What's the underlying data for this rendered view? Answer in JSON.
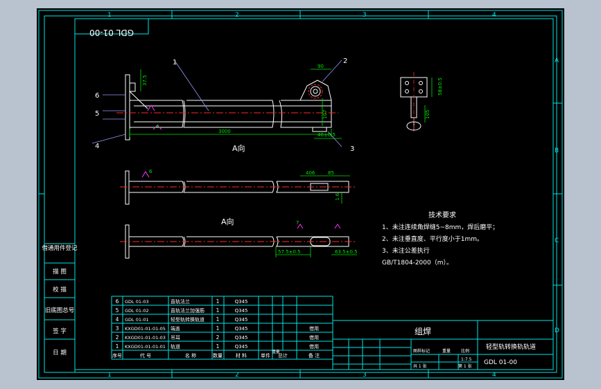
{
  "colors": {
    "background": "#b9c2cf",
    "sheet": "#000000",
    "frame": "#00e6e6",
    "object": "#ffffff",
    "center_line": "#ff2a2a",
    "dimension": "#00e600",
    "annotation": "#00e600",
    "leader": "#9999ff",
    "weld": "#ff33ff"
  },
  "border_zones": {
    "columns": [
      "1",
      "2",
      "3",
      "4"
    ],
    "rows": [
      "A",
      "B",
      "C",
      "D"
    ]
  },
  "drawing_code_mirrored": "GDL 01-00",
  "views": {
    "main_view_label": "A向",
    "bottom_view_label": "A向"
  },
  "balloons": [
    "1",
    "2",
    "3",
    "4",
    "5",
    "6"
  ],
  "dimensions": {
    "overall_length": "3000",
    "d_90": "90",
    "d_46": "46±0.5",
    "d_37": "37.5",
    "d_107": "107",
    "d_4": "4",
    "d_58": "58±0.5",
    "d_105": "105",
    "d_406": "406",
    "d_85": "85",
    "d_16": "1.6",
    "d_575": "57.5±0.5",
    "d_635": "63.5±0.5",
    "weld_6": "6",
    "weld_7": "7"
  },
  "technical_requirements": {
    "title": "技术要求",
    "lines": [
      "1、未注连续角焊缝5~8mm，焊后磨平；",
      "2、未注垂直度、平行度小于1mm。",
      "3、未注公差执行",
      "GB/T1804-2000（m）。"
    ]
  },
  "side_panel": {
    "items": [
      "借通用件登记",
      "描  图",
      "校  描",
      "旧底图总号",
      "签  字",
      "日  期"
    ]
  },
  "bom": {
    "headers": [
      "序号",
      "代  号",
      "名  称",
      "数量",
      "材  料",
      "单件",
      "总计",
      "备  注"
    ],
    "weight_header": "重量",
    "rows": [
      {
        "no": "6",
        "code": "GDL 01-03",
        "name": "直轨法兰",
        "qty": "1",
        "material": "Q345",
        "remark": ""
      },
      {
        "no": "5",
        "code": "GDL 01-02",
        "name": "直轨法兰加强筋",
        "qty": "1",
        "material": "Q345",
        "remark": ""
      },
      {
        "no": "4",
        "code": "GDL 01-01",
        "name": "轻型轨转换轨道",
        "qty": "1",
        "material": "Q345",
        "remark": ""
      },
      {
        "no": "3",
        "code": "KXGD01-01-01-05",
        "name": "端盖",
        "qty": "1",
        "material": "Q345",
        "remark": "借用"
      },
      {
        "no": "2",
        "code": "KXGD01-01-01-03",
        "name": "吊耳",
        "qty": "2",
        "material": "Q345",
        "remark": "借用"
      },
      {
        "no": "1",
        "code": "KXGD01-01-01-01",
        "name": "轨道",
        "qty": "1",
        "material": "Q345",
        "remark": "借用"
      }
    ]
  },
  "title_block": {
    "assembly_type": "组焊",
    "title": "轻型轨转换轨轨道",
    "drawing_no": "GDL 01-00",
    "scale": "1:7.5",
    "sheets": "第 1 张",
    "labels": {
      "stage": "图样标记",
      "weight": "重量",
      "scale_label": "比例",
      "total_sheets": "共 1 张"
    }
  }
}
